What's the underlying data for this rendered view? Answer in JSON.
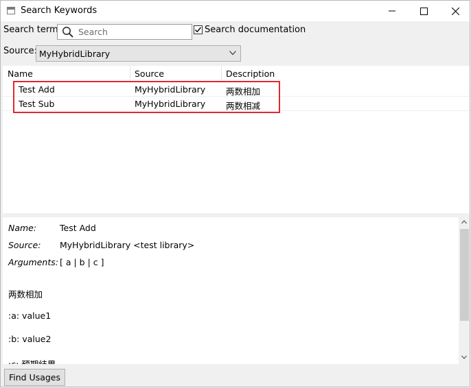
{
  "window": {
    "title": "Search Keywords",
    "controls": [
      "minimize-icon",
      "maximize-icon",
      "close-icon"
    ]
  },
  "search": {
    "label": "Search term:",
    "placeholder": "Search",
    "value": "",
    "icon": "search-icon",
    "doc_checkbox_label": "Search documentation",
    "doc_checkbox_checked": true
  },
  "source": {
    "label": "Source:",
    "selected": "MyHybridLibrary"
  },
  "table": {
    "columns": [
      "Name",
      "Source",
      "Description"
    ],
    "rows": [
      {
        "name": "Test Add",
        "source": "MyHybridLibrary",
        "description": "两数相加"
      },
      {
        "name": "Test Sub",
        "source": "MyHybridLibrary",
        "description": "两数相减"
      }
    ],
    "highlight_color": "#e0282e"
  },
  "details": {
    "name_label": "Name:",
    "name_value": "Test Add",
    "source_label": "Source:",
    "source_value": "MyHybridLibrary <test library>",
    "arguments_label": "Arguments:",
    "arguments_value": "[ a | b | c ]",
    "doc_lines": [
      "两数相加",
      ":a: value1",
      ":b: value2",
      ":c: 预期结果"
    ]
  },
  "footer": {
    "find_usages_label": "Find Usages"
  }
}
